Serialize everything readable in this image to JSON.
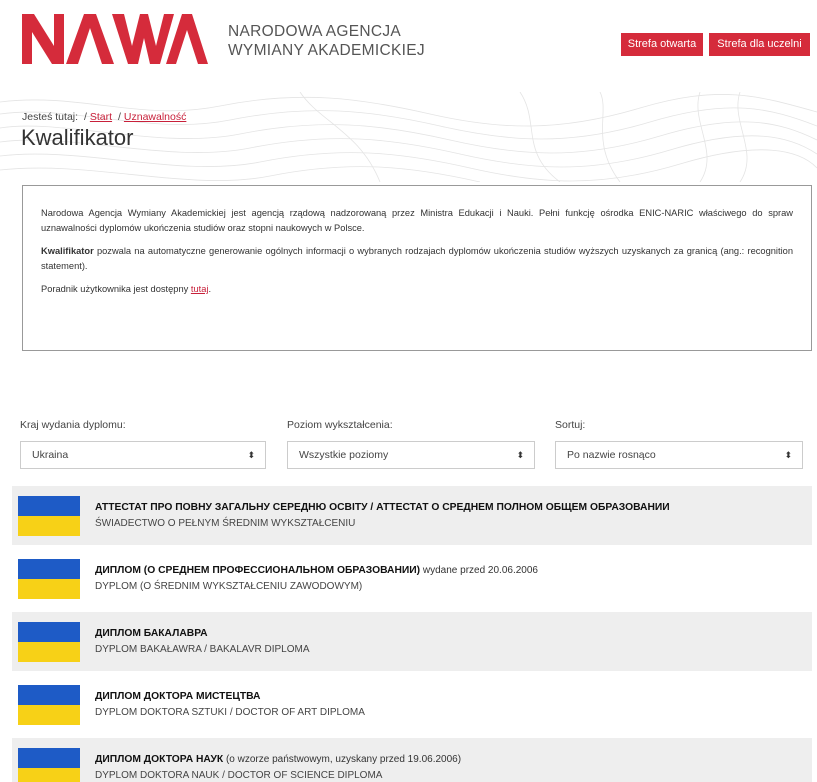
{
  "header": {
    "logo_text": "NAWA",
    "agency_line1": "NARODOWA AGENCJA",
    "agency_line2": "WYMIANY AKADEMICKIEJ",
    "btn_open": "Strefa otwarta",
    "btn_uni": "Strefa dla uczelni"
  },
  "breadcrumb": {
    "prefix": "Jesteś tutaj:",
    "sep": "/",
    "start": "Start",
    "current": "Uznawalność"
  },
  "page_title": "Kwalifikator",
  "info": {
    "p1": "Narodowa Agencja Wymiany Akademickiej jest agencją rządową nadzorowaną przez Ministra Edukacji i Nauki. Pełni funkcję ośrodka ENIC-NARIC właściwego do spraw uznawalności dyplomów ukończenia studiów oraz stopni naukowych w Polsce.",
    "p2_bold": "Kwalifikator",
    "p2_rest": " pozwala na automatyczne generowanie ogólnych informacji o wybranych rodzajach dyplomów ukończenia studiów wyższych uzyskanych za granicą (ang.: recognition statement).",
    "p3_text": "Poradnik użytkownika jest dostępny ",
    "p3_link": "tutaj",
    "p3_end": "."
  },
  "filters": {
    "country_label": "Kraj wydania dyplomu:",
    "country_value": "Ukraina",
    "level_label": "Poziom wykształcenia:",
    "level_value": "Wszystkie poziomy",
    "sort_label": "Sortuj:",
    "sort_value": "Po nazwie rosnąco",
    "caret": "⬍"
  },
  "results": [
    {
      "title": "АТТЕСТАТ ПРО ПОВНУ ЗАГАЛЬНУ СЕРЕДНЮ ОСВІТУ / АТТЕСТАТ О СРЕДНЕМ ПОЛНОМ ОБЩЕМ ОБРАЗОВАНИИ",
      "note": "",
      "subtitle": "ŚWIADECTWO O PEŁNYM ŚREDNIM WYKSZTAŁCENIU"
    },
    {
      "title": "ДИПЛОМ (О СРЕДНЕМ ПРОФЕССИОНАЛЬНОМ ОБРАЗОВАНИИ)",
      "note": " wydane przed 20.06.2006",
      "subtitle": "DYPLOM (O ŚREDNIM WYKSZTAŁCENIU ZAWODOWYM)"
    },
    {
      "title": "ДИПЛОМ БАКАЛАВРА",
      "note": "",
      "subtitle": "DYPLOM BAKAŁAWRA / BAKALAVR DIPLOMA"
    },
    {
      "title": "ДИПЛОМ ДОКТОРА МИСТЕЦТВА",
      "note": "",
      "subtitle": "DYPLOM DOKTORA SZTUKI / DOCTOR OF ART DIPLOMA"
    },
    {
      "title": "ДИПЛОМ ДОКТОРА НАУК",
      "note": " (o wzorze państwowym, uzyskany przed 19.06.2006)",
      "subtitle": "DYPLOM DOKTORA NAUK / DOCTOR OF SCIENCE DIPLOMA"
    }
  ],
  "colors": {
    "brand_red": "#d52b3b",
    "flag_blue": "#1e5bc6",
    "flag_yellow": "#f7d117"
  }
}
